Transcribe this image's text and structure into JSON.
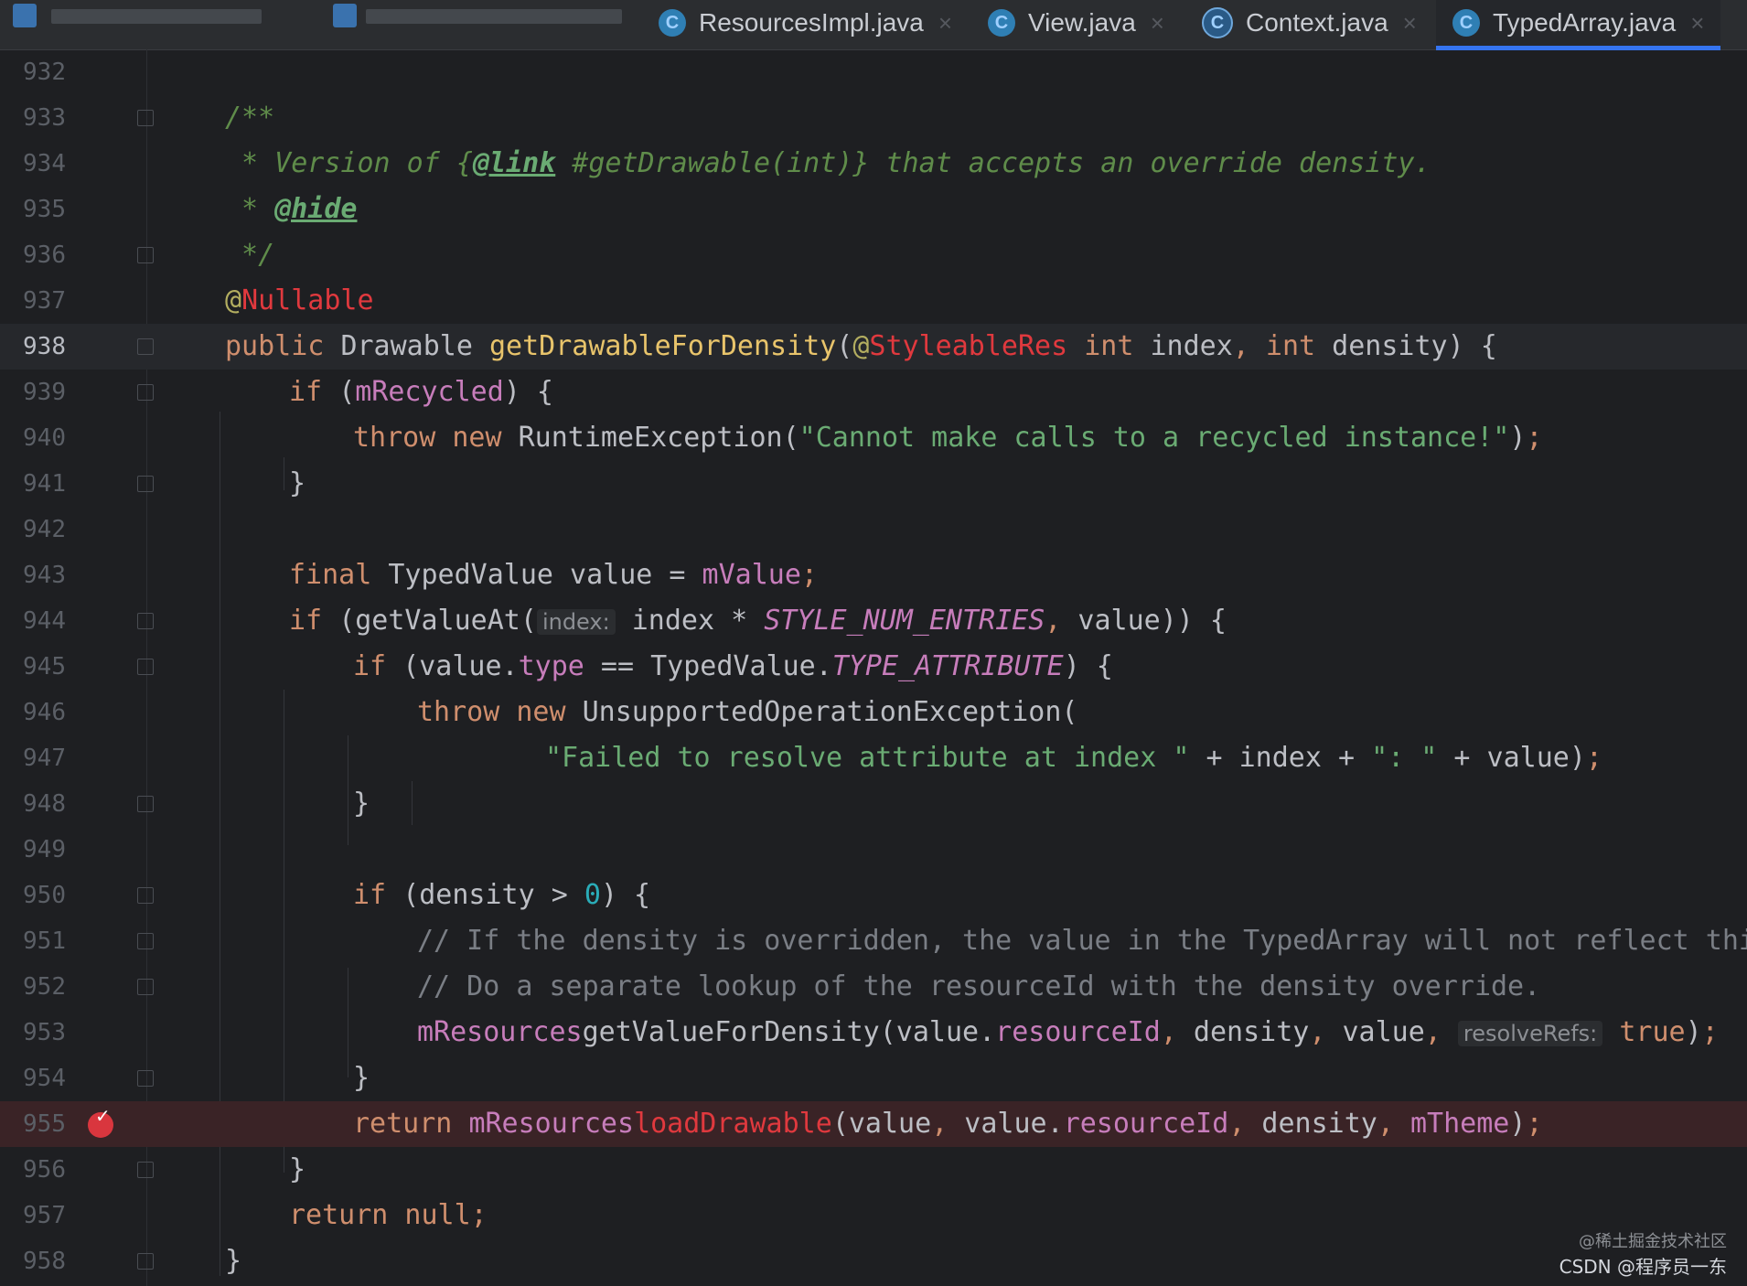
{
  "tabs": [
    {
      "label": "ResourcesImpl.java",
      "icon": "class-icon",
      "active": false
    },
    {
      "label": "View.java",
      "icon": "class-icon",
      "active": false
    },
    {
      "label": "Context.java",
      "icon": "abstract-class-icon",
      "active": false
    },
    {
      "label": "TypedArray.java",
      "icon": "class-icon",
      "active": true
    }
  ],
  "tab_icon_letter": "C",
  "tab_close_glyph": "×",
  "editor": {
    "current_line": "938",
    "breakpoint_line": "955",
    "lines": [
      {
        "n": "932"
      },
      {
        "n": "933",
        "t1": "/**"
      },
      {
        "n": "934",
        "t1": " * Version of {",
        "t2": "@link",
        "t3": " #getDrawable(int)} that accepts an override density."
      },
      {
        "n": "935",
        "t1": " * ",
        "t2": "@hide"
      },
      {
        "n": "936",
        "t1": " */"
      },
      {
        "n": "937",
        "t1": "@",
        "t2": "Nullable"
      },
      {
        "n": "938",
        "t1": "public ",
        "t2": "Drawable ",
        "t3": "getDrawableForDensity",
        "t4": "(",
        "t5": "@",
        "t6": "StyleableRes",
        "t7": " int ",
        "t8": "index",
        ",": ",",
        "t9": " int ",
        "t10": "density) {"
      },
      {
        "n": "939",
        "t1": "if ",
        "t2": "(",
        "t3": "mRecycled",
        "t4": ") {"
      },
      {
        "n": "940",
        "t1": "throw new ",
        "t2": "RuntimeException(",
        "t3": "\"Cannot make calls to a recycled instance!\"",
        "t4": ")",
        ";": ";"
      },
      {
        "n": "941",
        "t1": "}"
      },
      {
        "n": "942"
      },
      {
        "n": "943",
        "t1": "final ",
        "t2": "TypedValue value = ",
        "t3": "mValue",
        ";": ";"
      },
      {
        "n": "944",
        "t1": "if ",
        "t2": "(getValueAt(",
        "hint": "index:",
        "t3": " index * ",
        "t4": "STYLE_NUM_ENTRIES",
        ",": ",",
        "t5": " value)) {"
      },
      {
        "n": "945",
        "t1": "if ",
        "t2": "(value.",
        "t3": "type",
        "t4": " == TypedValue.",
        "t5": "TYPE_ATTRIBUTE",
        "t6": ") {"
      },
      {
        "n": "946",
        "t1": "throw new ",
        "t2": "UnsupportedOperationException("
      },
      {
        "n": "947",
        "t1": "\"Failed to resolve attribute at index \"",
        "t2": " + index + ",
        "t3": "\": \"",
        "t4": " + value)",
        ";": ";"
      },
      {
        "n": "948",
        "t1": "}"
      },
      {
        "n": "949"
      },
      {
        "n": "950",
        "t1": "if ",
        "t2": "(density > ",
        "t3": "0",
        "t4": ") {"
      },
      {
        "n": "951",
        "t1": "// If the density is overridden, the value in the TypedArray will not reflect this."
      },
      {
        "n": "952",
        "t1": "// Do a separate lookup of the resourceId with the density override."
      },
      {
        "n": "953",
        "t1": "mResources",
        ".": ".",
        "t2": "getValueForDensity(value.",
        "t3": "resourceId",
        ",": ",",
        "t4": " density",
        ",2": ",",
        "t5": " value",
        ",3": ",",
        "hint": "resolveRefs:",
        "t6": " true",
        "t7": ")",
        ";": ";"
      },
      {
        "n": "954",
        "t1": "}"
      },
      {
        "n": "955",
        "t1": "return ",
        "t2": "mResources",
        ".": ".",
        "t3": "loadDrawable",
        "t4": "(value",
        ",": ",",
        "t5": " value.",
        "t6": "resourceId",
        ",2": ",",
        "t7": " density",
        ",3": ",",
        "t8": " mTheme",
        "t9": ")",
        ";": ";"
      },
      {
        "n": "956",
        "t1": "}"
      },
      {
        "n": "957",
        "t1": "return null;"
      },
      {
        "n": "958",
        "t1": "}"
      }
    ]
  },
  "breakpoint_check": "✓",
  "watermark": {
    "line1": "@稀土掘金技术社区",
    "line2": "CSDN @程序员一东"
  }
}
